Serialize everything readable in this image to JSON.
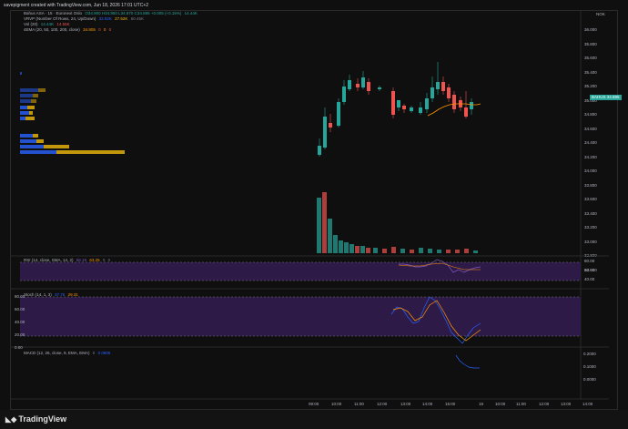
{
  "header": {
    "caption": "savepigment created with TradingView.com, Jun 18, 2026 17:01 UTC+2"
  },
  "currency": "NOK",
  "symbol": {
    "title": "Bahus ASA · 15 · Euronext Oslo",
    "ohlc": "O34.900 H34.950 L34.870 C34.895 +0.005 (+0.15%)",
    "last": "14.44K",
    "badge": "BAHUS",
    "badge_price": "34.895"
  },
  "indicators": {
    "vrvp": {
      "name": "VRVP (Number Of Rows, 24, Up/Down)",
      "v1": "32.92K",
      "v2": "27.52K",
      "v3": "60.45K"
    },
    "vol": {
      "name": "Vol (20)",
      "v1": "14.44K",
      "v2": "14.55K"
    },
    "ema": {
      "name": "4EMA (20, 50, 100, 200, close)",
      "v1": "34.805",
      "v2": "0",
      "v3": "0",
      "v4": "0"
    },
    "rsi": {
      "name": "RSI (14, close, SMA, 14, 2)",
      "v1": "58.19",
      "v2": "63.25",
      "v3": "0",
      "v4": "0"
    },
    "stoch": {
      "name": "Stoch (14, 1, 3)",
      "v1": "37.76",
      "v2": "29.31"
    },
    "macd": {
      "name": "MACD (12, 26, close, 9, EMA, EMA)",
      "v1": "0",
      "v2": "0.0805"
    }
  },
  "price_axis": [
    "36.000",
    "35.800",
    "35.600",
    "35.400",
    "35.200",
    "35.000",
    "34.800",
    "34.600",
    "34.400",
    "34.200",
    "34.000",
    "33.800",
    "33.600",
    "33.400",
    "33.200",
    "33.000",
    "32.800",
    "32.600"
  ],
  "rsi_axis": [
    "80.00",
    "60.00",
    "40.00"
  ],
  "stoch_axis": [
    "80.00",
    "60.00",
    "40.00",
    "20.00",
    "0.00"
  ],
  "macd_axis": [
    "0.2000",
    "0.1000",
    "0.0000"
  ],
  "time_axis": [
    "09:00",
    "10:00",
    "11:00",
    "12:00",
    "13:00",
    "14:00",
    "15:00",
    "19",
    "10:00",
    "11:00",
    "12:00",
    "13:00",
    "14:00"
  ],
  "colors": {
    "up": "#26a69a",
    "down": "#ef5350",
    "ema": "#ff9800",
    "rsi": "#7e57c2",
    "vp_up": "#2962ff",
    "vp_down": "#f0b90b"
  },
  "footer": {
    "logo": "TradingView"
  }
}
